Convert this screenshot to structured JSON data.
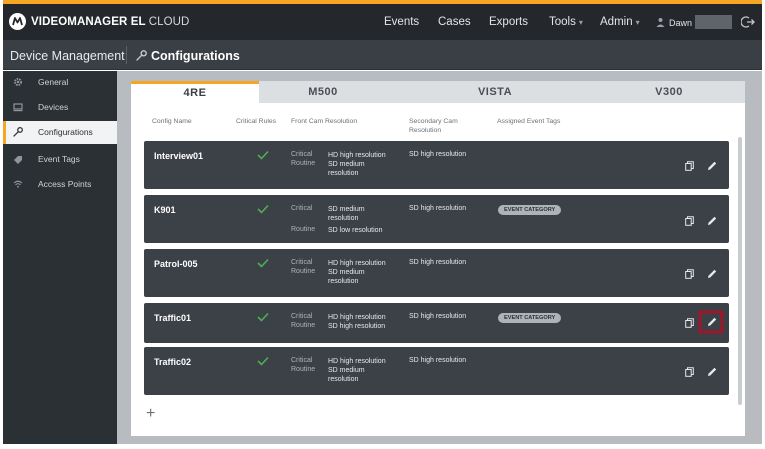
{
  "header": {
    "brand_bold": "VIDEOMANAGER EL",
    "brand_thin": "CLOUD",
    "nav": [
      {
        "label": "Events"
      },
      {
        "label": "Cases"
      },
      {
        "label": "Exports"
      },
      {
        "label": "Tools",
        "caret": "▾"
      },
      {
        "label": "Admin",
        "caret": "▾"
      }
    ],
    "user_name": "Dawn"
  },
  "subheader": {
    "section": "Device Management",
    "page": "Configurations"
  },
  "sidebar": {
    "items": [
      {
        "label": "General",
        "icon": "gear-icon"
      },
      {
        "label": "Devices",
        "icon": "devices-icon"
      },
      {
        "label": "Configurations",
        "icon": "wrench-icon",
        "active": true
      },
      {
        "label": "Event Tags",
        "icon": "tag-icon"
      },
      {
        "label": "Access Points",
        "icon": "wifi-icon"
      }
    ]
  },
  "tabs": [
    "4RE",
    "M500",
    "VISTA",
    "V300"
  ],
  "active_tab": "4RE",
  "columns": {
    "name": "Config Name",
    "rules": "Critical Rules",
    "front": "Front Cam Resolution",
    "secondary": "Secondary Cam Resolution",
    "tags": "Assigned Event Tags"
  },
  "rows": [
    {
      "name": "Interview01",
      "critical_label": "Critical",
      "critical_res": "HD high resolution",
      "routine_label": "Routine",
      "routine_res": "SD medium resolution",
      "secondary": "SD high resolution",
      "tag": ""
    },
    {
      "name": "K901",
      "critical_label": "Critical",
      "critical_res": "SD medium resolution",
      "routine_label": "Routine",
      "routine_res": "SD low resolution",
      "secondary": "SD high resolution",
      "tag": "EVENT CATEGORY"
    },
    {
      "name": "Patrol-005",
      "critical_label": "Critical",
      "critical_res": "HD high resolution",
      "routine_label": "Routine",
      "routine_res": "SD medium resolution",
      "secondary": "SD high resolution",
      "tag": ""
    },
    {
      "name": "Traffic01",
      "critical_label": "Critical",
      "critical_res": "HD high resolution",
      "routine_label": "Routine",
      "routine_res": "SD high resolution",
      "secondary": "SD high resolution",
      "tag": "EVENT CATEGORY",
      "highlighted_edit": true
    },
    {
      "name": "Traffic02",
      "critical_label": "Critical",
      "critical_res": "HD high resolution",
      "routine_label": "Routine",
      "routine_res": "SD medium resolution",
      "secondary": "SD high resolution",
      "tag": ""
    }
  ],
  "add_label": "+",
  "colors": {
    "accent": "#f5a623",
    "topbar": "#24272c",
    "row_bg": "#3c4148",
    "check": "#4caf50",
    "highlight": "#d0021b"
  }
}
